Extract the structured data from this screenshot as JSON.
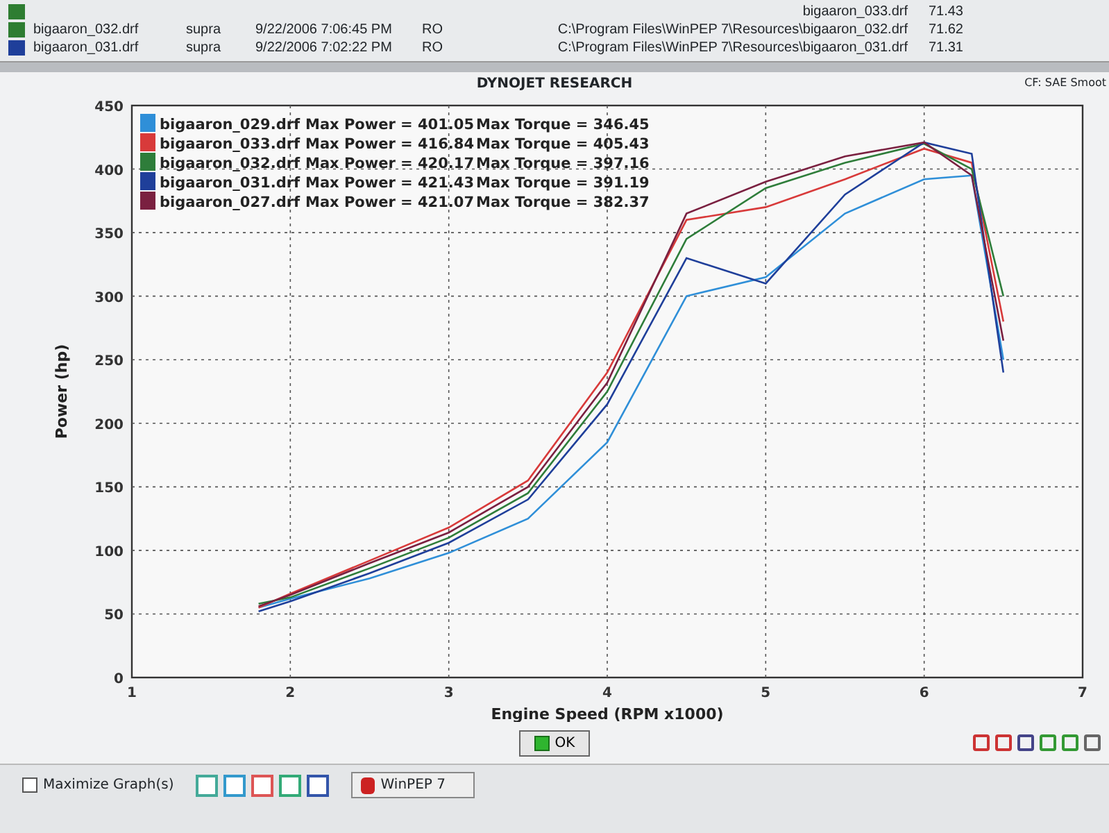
{
  "file_list": {
    "rows": [
      {
        "cells": [
          null,
          null,
          null,
          null,
          "bigaaron_033.drf",
          "71.43"
        ],
        "color": "#2e7d32"
      },
      {
        "cells": [
          "bigaaron_032.drf",
          "supra",
          "9/22/2006 7:06:45 PM",
          "RO",
          "C:\\Program Files\\WinPEP 7\\Resources\\bigaaron_032.drf",
          "71.62"
        ],
        "color": "#2e7d32"
      },
      {
        "cells": [
          "bigaaron_031.drf",
          "supra",
          "9/22/2006 7:02:22 PM",
          "RO",
          "C:\\Program Files\\WinPEP 7\\Resources\\bigaaron_031.drf",
          "71.31"
        ],
        "color": "#1f3f9a"
      }
    ]
  },
  "graph": {
    "title": "DYNOJET RESEARCH",
    "correction": "CF: SAE Smoot",
    "legend": [
      {
        "power": "Max Power = 401.05",
        "torque": "Max Torque = 346.45"
      },
      {
        "power": "Max Power = 416.84",
        "torque": "Max Torque = 405.43"
      },
      {
        "power": "Max Power = 420.17",
        "torque": "Max Torque = 397.16"
      },
      {
        "power": "Max Power = 421.43",
        "torque": "Max Torque = 391.19"
      },
      {
        "power": "Max Power = 421.07",
        "torque": "Max Torque = 382.37"
      }
    ],
    "chart_data": {
      "type": "line",
      "xlabel": "Engine Speed (RPM x1000)",
      "ylabel": "Power (hp)",
      "grid": true,
      "legend": true,
      "x": [
        1.8,
        2,
        2.5,
        3,
        3.5,
        4,
        4.5,
        5,
        5.5,
        6,
        6.3,
        6.5
      ],
      "series": [
        {
          "name": "bigaaron_029.drf",
          "color": "#2f8fd8",
          "values": [
            55,
            62,
            78,
            98,
            125,
            185,
            300,
            315,
            365,
            392,
            395,
            250
          ]
        },
        {
          "name": "bigaaron_033.drf",
          "color": "#d83a3a",
          "values": [
            55,
            66,
            92,
            118,
            155,
            240,
            360,
            370,
            392,
            416,
            405,
            280
          ]
        },
        {
          "name": "bigaaron_032.drf",
          "color": "#2e7d3a",
          "values": [
            58,
            63,
            86,
            110,
            145,
            225,
            345,
            385,
            405,
            420,
            400,
            300
          ]
        },
        {
          "name": "bigaaron_031.drf",
          "color": "#1f3f9a",
          "values": [
            52,
            60,
            82,
            106,
            140,
            215,
            330,
            310,
            380,
            421,
            412,
            240
          ]
        },
        {
          "name": "bigaaron_027.drf",
          "color": "#7a2040",
          "values": [
            56,
            65,
            90,
            114,
            150,
            232,
            365,
            390,
            410,
            421,
            395,
            265
          ]
        }
      ],
      "xlim": [
        1,
        7
      ],
      "ylim": [
        0,
        450
      ],
      "xticks": [
        1,
        2,
        3,
        4,
        5,
        6,
        7
      ],
      "yticks": [
        0,
        50,
        100,
        150,
        200,
        250,
        300,
        350,
        400,
        450
      ]
    },
    "ok_button": "OK"
  },
  "footer": {
    "maximize": {
      "label": "Maximize Graph(s)",
      "checked": false
    },
    "taskbar_button": "WinPEP 7"
  }
}
